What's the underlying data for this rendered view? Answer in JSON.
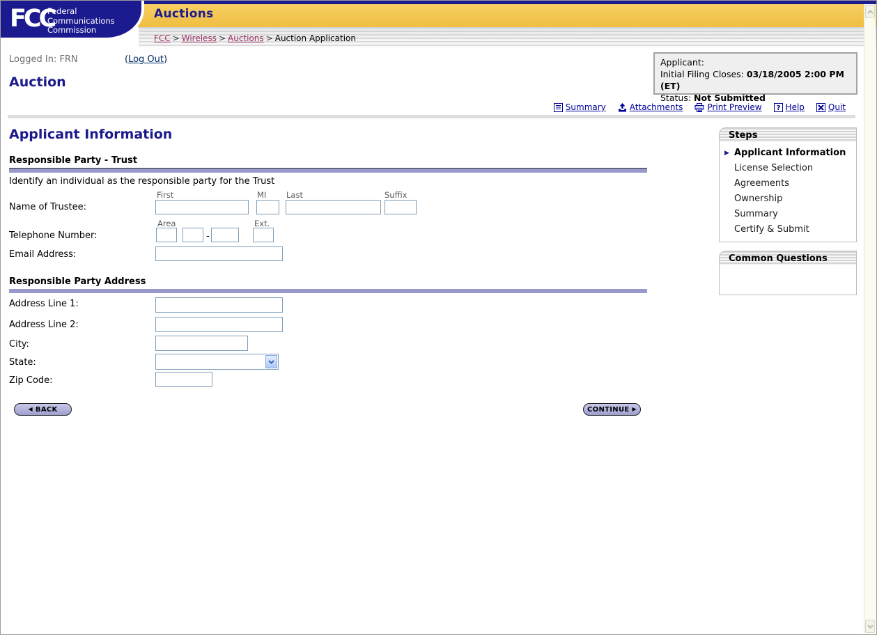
{
  "header": {
    "logo_text": "FCC",
    "org_lines": [
      "Federal",
      "Communications",
      "Commission"
    ],
    "app_title": "Auctions",
    "breadcrumb": {
      "separator": ">",
      "links": [
        "FCC",
        "Wireless",
        "Auctions"
      ],
      "current": "Auction Application"
    }
  },
  "session": {
    "logged_in": "Logged In: FRN",
    "paren_open": "(",
    "logout": "Log Out",
    "paren_close": ")"
  },
  "page_title": "Auction",
  "applicant_box": {
    "applicant_label": "Applicant:",
    "filing_label": "Initial Filing Closes: ",
    "filing_value": "03/18/2005 2:00 PM (ET)",
    "status_label": "Status: ",
    "status_value": "Not Submitted"
  },
  "toolbar": {
    "items": [
      {
        "label": "Summary",
        "icon": "summary-icon"
      },
      {
        "label": "Attachments",
        "icon": "attachments-icon"
      },
      {
        "label": "Print Preview",
        "icon": "print-preview-icon"
      },
      {
        "label": "Help",
        "icon": "help-icon"
      },
      {
        "label": "Quit",
        "icon": "quit-icon"
      }
    ]
  },
  "main": {
    "heading": "Applicant Information",
    "trust_section": {
      "title": "Responsible Party - Trust",
      "description": "Identify an individual as the responsible party for the Trust",
      "name_row": {
        "label": "Name of Trustee:",
        "first_label": "First",
        "mi_label": "MI",
        "last_label": "Last",
        "suffix_label": "Suffix",
        "first_value": "",
        "mi_value": "",
        "last_value": "",
        "suffix_value": ""
      },
      "phone_row": {
        "label": "Telephone Number:",
        "area_label": "Area",
        "ext_label": "Ext.",
        "hyphen": "-",
        "area_value": "",
        "prefix_value": "",
        "line_value": "",
        "ext_value": ""
      },
      "email_row": {
        "label": "Email Address:",
        "value": ""
      }
    },
    "address_section": {
      "title": "Responsible Party Address",
      "rows": [
        {
          "label": "Address Line 1:",
          "value": ""
        },
        {
          "label": "Address Line 2:",
          "value": ""
        },
        {
          "label": "City:",
          "value": ""
        },
        {
          "label": "State:",
          "value": ""
        },
        {
          "label": "Zip Code:",
          "value": ""
        }
      ]
    },
    "back_button": "BACK",
    "back_icon": "◀",
    "continue_button": "CONTINUE",
    "continue_icon": "▶"
  },
  "steps_panel": {
    "title": "Steps",
    "marker_icon": "▶",
    "items": [
      {
        "label": "Applicant Information",
        "current": true
      },
      {
        "label": "License Selection",
        "current": false
      },
      {
        "label": "Agreements",
        "current": false
      },
      {
        "label": "Ownership",
        "current": false
      },
      {
        "label": "Summary",
        "current": false
      },
      {
        "label": "Certify & Submit",
        "current": false
      }
    ]
  },
  "common_questions_panel": {
    "title": "Common Questions"
  },
  "colors": {
    "navy": "#1B1B8F",
    "gold": "#F3C74F",
    "lavender_bar": "#9999CC",
    "link_navy": "#000099",
    "breadcrumb_link": "#993366",
    "input_border": "#7F9DB9",
    "button_fill": "#AAAADC"
  }
}
